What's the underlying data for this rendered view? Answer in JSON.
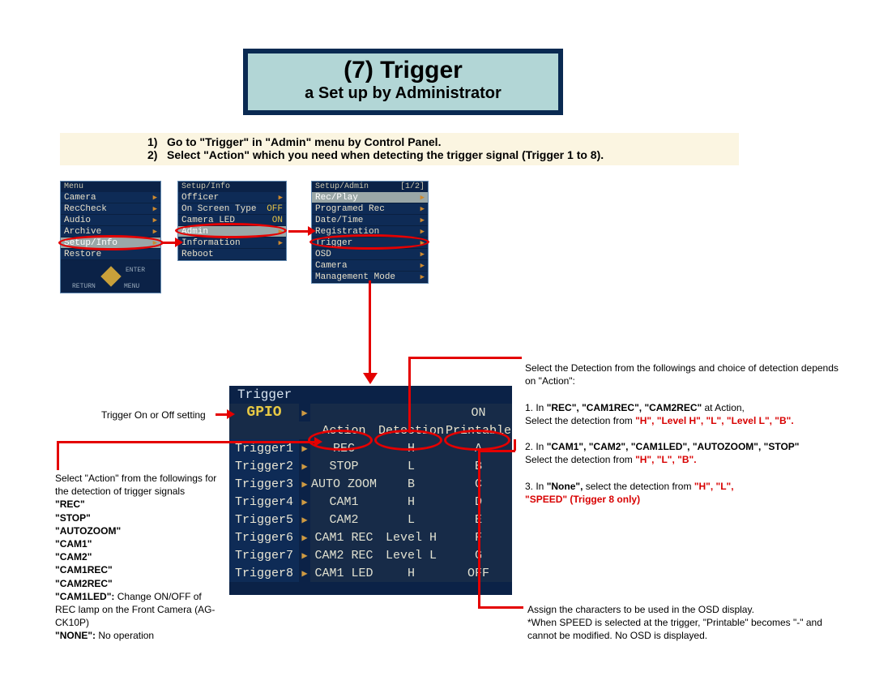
{
  "header": {
    "title": "(7) Trigger",
    "subtitle": "a  Set up by Administrator"
  },
  "instructions": {
    "n1": "1)",
    "t1": "Go to \"Trigger\" in \"Admin\" menu by Control Panel.",
    "n2": "2)",
    "t2": "Select \"Action\" which you need when detecting the trigger signal (Trigger 1 to 8)."
  },
  "menu1": {
    "hdr": "Menu",
    "r0": "Camera",
    "r1": "RecCheck",
    "r2": "Audio",
    "r3": "Archive",
    "r4": "Setup/Info",
    "r5": "Restore",
    "foot_enter": "ENTER",
    "foot_return": "RETURN",
    "foot_menu": "MENU"
  },
  "menu2": {
    "hdr": "Setup/Info",
    "r0": "Officer",
    "r1": "On Screen Type",
    "r1v": "OFF",
    "r2": "Camera LED",
    "r2v": "ON",
    "r3": "Admin",
    "r4": "Information",
    "r5": "Reboot"
  },
  "menu3": {
    "hdr": "Setup/Admin",
    "page": "[1/2]",
    "r0": "Rec/Play",
    "r1": "Programed Rec",
    "r2": "Date/Time",
    "r3": "Registration",
    "r4": "Trigger",
    "r5": "OSD",
    "r6": "Camera",
    "r7": "Management Mode"
  },
  "leftNote1": "Trigger On or Off setting",
  "leftNote2": {
    "l1": "Select  \"Action\" from the followings for the detection of trigger signals",
    "opt1": "\"REC\"",
    "opt2": "\"STOP\"",
    "opt3": "\"AUTOZOOM\"",
    "opt4": "\"CAM1\"",
    "opt5": "\"CAM2\"",
    "opt6": "\"CAM1REC\"",
    "opt7": "\"CAM2REC\"",
    "cam1led_b": "\"CAM1LED\":",
    "cam1led_t": " Change ON/OFF of REC lamp on the Front Camera (AG-CK10P)",
    "none_b": "\"NONE\":",
    "none_t": "  No operation"
  },
  "rightNote1": {
    "l1": "Select the Detection from the followings and choice of detection depends on \"Action\":",
    "i1a": "1.  In ",
    "i1b": "\"REC\", \"CAM1REC\", \"CAM2REC\"",
    "i1c": " at Action,",
    "i1d": "Select the detection from ",
    "i1e": "\"H\", \"Level H\", \"L\", \"Level L\", \"B\".",
    "i2a": "2.  In ",
    "i2b": "\"CAM1\", \"CAM2\", \"CAM1LED\", \"AUTOZOOM\", \"STOP\"",
    "i2c": "Select the detection from ",
    "i2d": "\"H\", \"L\", \"B\".",
    "i3a": "3.  In ",
    "i3b": "\"None\",",
    "i3c": " select the detection from ",
    "i3d": "\"H\", \"L\",",
    "i3e": "\"SPEED\" (Trigger 8 only)"
  },
  "rightNote2": {
    "l1": "Assign the characters to be used in the OSD display.",
    "l2": "*When SPEED is selected at the trigger, \"Printable\" becomes \"-\" and cannot be modified.  No OSD is displayed."
  },
  "trigger": {
    "title": "Trigger",
    "gpio": "GPIO",
    "gpio_val": "ON",
    "hdr_action": "Action",
    "hdr_det": "Detection",
    "hdr_pr": "Printable",
    "rows": [
      {
        "name": "Trigger1",
        "action": "REC",
        "det": "H",
        "pr": "A"
      },
      {
        "name": "Trigger2",
        "action": "STOP",
        "det": "L",
        "pr": "B"
      },
      {
        "name": "Trigger3",
        "action": "AUTO ZOOM",
        "det": "B",
        "pr": "C"
      },
      {
        "name": "Trigger4",
        "action": "CAM1",
        "det": "H",
        "pr": "D"
      },
      {
        "name": "Trigger5",
        "action": "CAM2",
        "det": "L",
        "pr": "E"
      },
      {
        "name": "Trigger6",
        "action": "CAM1 REC",
        "det": "Level H",
        "pr": "F"
      },
      {
        "name": "Trigger7",
        "action": "CAM2 REC",
        "det": "Level L",
        "pr": "G"
      },
      {
        "name": "Trigger8",
        "action": "CAM1 LED",
        "det": "H",
        "pr": "OFF"
      }
    ]
  }
}
